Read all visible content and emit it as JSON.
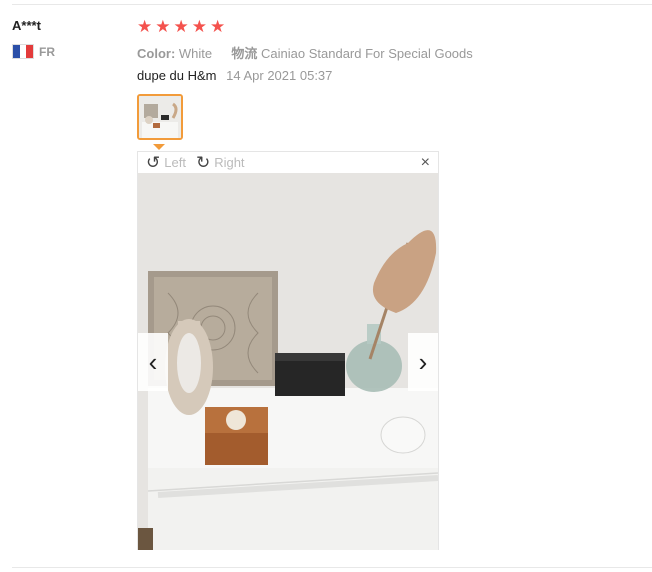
{
  "review": {
    "user": "A***t",
    "country_code": "FR",
    "flag_colors": [
      "#2b4fa8",
      "#ffffff",
      "#e33b3b"
    ],
    "rating": 5,
    "stars": [
      "★",
      "★",
      "★",
      "★",
      "★"
    ],
    "color_label": "Color:",
    "color_value": "White",
    "shipping_label": "物流",
    "shipping_value": "Cainiao Standard For Special Goods",
    "text": "dupe du H&m",
    "date": "14 Apr 2021 05:37"
  },
  "viewer": {
    "rotate_left_icon": "↺",
    "rotate_left_label": "Left",
    "rotate_right_icon": "↻",
    "rotate_right_label": "Right",
    "close_icon": "×",
    "prev_icon": "‹",
    "next_icon": "›"
  },
  "colors": {
    "star": "#f4524d",
    "thumb_border": "#f29b3a"
  }
}
